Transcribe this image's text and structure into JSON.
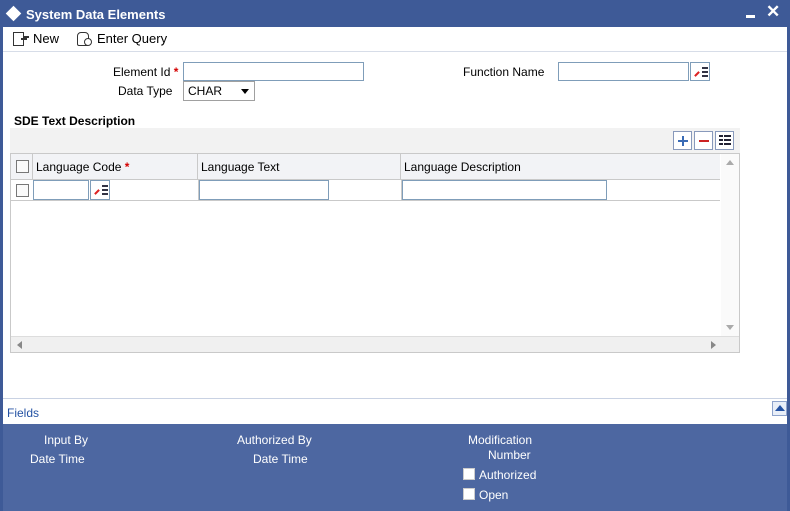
{
  "window": {
    "title": "System Data Elements"
  },
  "toolbar": {
    "new_label": "New",
    "enter_query_label": "Enter Query"
  },
  "form": {
    "element_id_label": "Element Id",
    "element_id_value": "",
    "function_name_label": "Function Name",
    "function_name_value": "",
    "data_type_label": "Data Type",
    "data_type_value": "CHAR",
    "required_mark": "*"
  },
  "sde_section": {
    "title": "SDE Text Description",
    "columns": [
      "Language Code",
      "Language Text",
      "Language Description"
    ],
    "rows": [
      {
        "language_code": "",
        "language_text": "",
        "language_description": ""
      }
    ]
  },
  "fields_bar": {
    "label": "Fields"
  },
  "audit": {
    "input_by": "Input By",
    "input_date_time": "Date Time",
    "authorized_by": "Authorized By",
    "auth_date_time": "Date Time",
    "modification_number_line1": "Modification",
    "modification_number_line2": "Number",
    "authorized_label": "Authorized",
    "open_label": "Open"
  },
  "icons": {
    "window": "diamond-icon",
    "new": "new-document-icon",
    "query": "enter-query-icon",
    "lov": "list-of-values-icon",
    "add_row": "plus-icon",
    "delete_row": "minus-icon",
    "view_row": "single-view-icon",
    "collapse": "collapse-up-icon"
  },
  "colors": {
    "title_bar": "#3e5a97",
    "audit_panel": "#4d67a1",
    "required": "#d40000",
    "link": "#2452a3"
  }
}
